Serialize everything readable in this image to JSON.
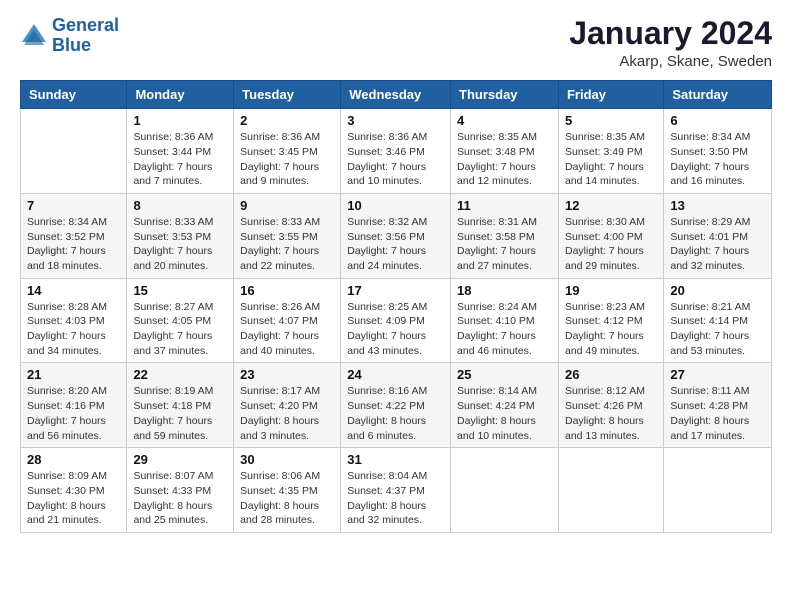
{
  "header": {
    "logo_line1": "General",
    "logo_line2": "Blue",
    "month_title": "January 2024",
    "location": "Akarp, Skane, Sweden"
  },
  "weekdays": [
    "Sunday",
    "Monday",
    "Tuesday",
    "Wednesday",
    "Thursday",
    "Friday",
    "Saturday"
  ],
  "weeks": [
    [
      {
        "day": "",
        "info": ""
      },
      {
        "day": "1",
        "info": "Sunrise: 8:36 AM\nSunset: 3:44 PM\nDaylight: 7 hours\nand 7 minutes."
      },
      {
        "day": "2",
        "info": "Sunrise: 8:36 AM\nSunset: 3:45 PM\nDaylight: 7 hours\nand 9 minutes."
      },
      {
        "day": "3",
        "info": "Sunrise: 8:36 AM\nSunset: 3:46 PM\nDaylight: 7 hours\nand 10 minutes."
      },
      {
        "day": "4",
        "info": "Sunrise: 8:35 AM\nSunset: 3:48 PM\nDaylight: 7 hours\nand 12 minutes."
      },
      {
        "day": "5",
        "info": "Sunrise: 8:35 AM\nSunset: 3:49 PM\nDaylight: 7 hours\nand 14 minutes."
      },
      {
        "day": "6",
        "info": "Sunrise: 8:34 AM\nSunset: 3:50 PM\nDaylight: 7 hours\nand 16 minutes."
      }
    ],
    [
      {
        "day": "7",
        "info": "Sunrise: 8:34 AM\nSunset: 3:52 PM\nDaylight: 7 hours\nand 18 minutes."
      },
      {
        "day": "8",
        "info": "Sunrise: 8:33 AM\nSunset: 3:53 PM\nDaylight: 7 hours\nand 20 minutes."
      },
      {
        "day": "9",
        "info": "Sunrise: 8:33 AM\nSunset: 3:55 PM\nDaylight: 7 hours\nand 22 minutes."
      },
      {
        "day": "10",
        "info": "Sunrise: 8:32 AM\nSunset: 3:56 PM\nDaylight: 7 hours\nand 24 minutes."
      },
      {
        "day": "11",
        "info": "Sunrise: 8:31 AM\nSunset: 3:58 PM\nDaylight: 7 hours\nand 27 minutes."
      },
      {
        "day": "12",
        "info": "Sunrise: 8:30 AM\nSunset: 4:00 PM\nDaylight: 7 hours\nand 29 minutes."
      },
      {
        "day": "13",
        "info": "Sunrise: 8:29 AM\nSunset: 4:01 PM\nDaylight: 7 hours\nand 32 minutes."
      }
    ],
    [
      {
        "day": "14",
        "info": "Sunrise: 8:28 AM\nSunset: 4:03 PM\nDaylight: 7 hours\nand 34 minutes."
      },
      {
        "day": "15",
        "info": "Sunrise: 8:27 AM\nSunset: 4:05 PM\nDaylight: 7 hours\nand 37 minutes."
      },
      {
        "day": "16",
        "info": "Sunrise: 8:26 AM\nSunset: 4:07 PM\nDaylight: 7 hours\nand 40 minutes."
      },
      {
        "day": "17",
        "info": "Sunrise: 8:25 AM\nSunset: 4:09 PM\nDaylight: 7 hours\nand 43 minutes."
      },
      {
        "day": "18",
        "info": "Sunrise: 8:24 AM\nSunset: 4:10 PM\nDaylight: 7 hours\nand 46 minutes."
      },
      {
        "day": "19",
        "info": "Sunrise: 8:23 AM\nSunset: 4:12 PM\nDaylight: 7 hours\nand 49 minutes."
      },
      {
        "day": "20",
        "info": "Sunrise: 8:21 AM\nSunset: 4:14 PM\nDaylight: 7 hours\nand 53 minutes."
      }
    ],
    [
      {
        "day": "21",
        "info": "Sunrise: 8:20 AM\nSunset: 4:16 PM\nDaylight: 7 hours\nand 56 minutes."
      },
      {
        "day": "22",
        "info": "Sunrise: 8:19 AM\nSunset: 4:18 PM\nDaylight: 7 hours\nand 59 minutes."
      },
      {
        "day": "23",
        "info": "Sunrise: 8:17 AM\nSunset: 4:20 PM\nDaylight: 8 hours\nand 3 minutes."
      },
      {
        "day": "24",
        "info": "Sunrise: 8:16 AM\nSunset: 4:22 PM\nDaylight: 8 hours\nand 6 minutes."
      },
      {
        "day": "25",
        "info": "Sunrise: 8:14 AM\nSunset: 4:24 PM\nDaylight: 8 hours\nand 10 minutes."
      },
      {
        "day": "26",
        "info": "Sunrise: 8:12 AM\nSunset: 4:26 PM\nDaylight: 8 hours\nand 13 minutes."
      },
      {
        "day": "27",
        "info": "Sunrise: 8:11 AM\nSunset: 4:28 PM\nDaylight: 8 hours\nand 17 minutes."
      }
    ],
    [
      {
        "day": "28",
        "info": "Sunrise: 8:09 AM\nSunset: 4:30 PM\nDaylight: 8 hours\nand 21 minutes."
      },
      {
        "day": "29",
        "info": "Sunrise: 8:07 AM\nSunset: 4:33 PM\nDaylight: 8 hours\nand 25 minutes."
      },
      {
        "day": "30",
        "info": "Sunrise: 8:06 AM\nSunset: 4:35 PM\nDaylight: 8 hours\nand 28 minutes."
      },
      {
        "day": "31",
        "info": "Sunrise: 8:04 AM\nSunset: 4:37 PM\nDaylight: 8 hours\nand 32 minutes."
      },
      {
        "day": "",
        "info": ""
      },
      {
        "day": "",
        "info": ""
      },
      {
        "day": "",
        "info": ""
      }
    ]
  ]
}
